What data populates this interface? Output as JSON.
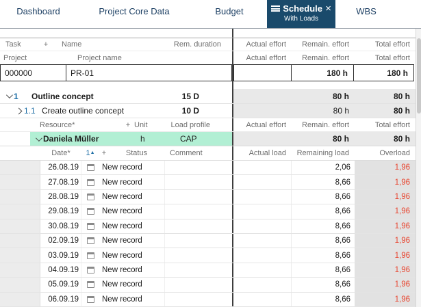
{
  "colors": {
    "active_tab": "#1a4a6b",
    "highlight_green": "#b2efd4",
    "overload_red": "#e8432d",
    "link_blue": "#1f6fa6"
  },
  "tabs": {
    "dashboard": "Dashboard",
    "project_core_data": "Project Core Data",
    "budget": "Budget",
    "schedule": "Schedule",
    "schedule_sub": "With Loads",
    "close": "×",
    "wbs": "WBS"
  },
  "table": {
    "header1": {
      "task": "Task",
      "add": "+",
      "name": "Name",
      "rem_duration": "Rem. duration",
      "actual_effort": "Actual effort",
      "remain_effort": "Remain. effort",
      "total_effort": "Total effort"
    },
    "header2": {
      "project": "Project",
      "project_name": "Project name",
      "actual_effort": "Actual effort",
      "remain_effort": "Remain. effort",
      "total_effort": "Total effort"
    },
    "project_row": {
      "id": "000000",
      "name": "PR-01",
      "actual_effort": "",
      "remain_effort": "180 h",
      "total_effort": "180 h"
    },
    "tasks": [
      {
        "num": "1",
        "name": "Outline concept",
        "rem_duration": "15 D",
        "actual_effort": "",
        "remain_effort": "80 h",
        "total_effort": "80 h"
      },
      {
        "num": "1.1",
        "name": "Create outline concept",
        "rem_duration": "10 D",
        "actual_effort": "",
        "remain_effort": "80 h",
        "total_effort": "80 h"
      }
    ],
    "resource_header": {
      "resource": "Resource*",
      "add": "+",
      "unit": "Unit",
      "load_profile": "Load profile",
      "actual_effort": "Actual effort",
      "remain_effort": "Remain. effort",
      "total_effort": "Total effort"
    },
    "resource": {
      "name": "Daniela Müller",
      "unit": "h",
      "load_profile": "CAP",
      "actual_effort": "",
      "remain_effort": "80 h",
      "total_effort": "80 h"
    },
    "load_header": {
      "date": "Date*",
      "sort": "1",
      "sort_arrow": "▲",
      "add": "+",
      "status": "Status",
      "comment": "Comment",
      "actual_load": "Actual load",
      "remaining_load": "Remaining load",
      "overload": "Overload"
    },
    "loads": [
      {
        "date": "26.08.19",
        "status": "New record",
        "comment": "",
        "actual_load": "",
        "remaining_load": "2,06",
        "overload": "1,96"
      },
      {
        "date": "27.08.19",
        "status": "New record",
        "comment": "",
        "actual_load": "",
        "remaining_load": "8,66",
        "overload": "1,96"
      },
      {
        "date": "28.08.19",
        "status": "New record",
        "comment": "",
        "actual_load": "",
        "remaining_load": "8,66",
        "overload": "1,96"
      },
      {
        "date": "29.08.19",
        "status": "New record",
        "comment": "",
        "actual_load": "",
        "remaining_load": "8,66",
        "overload": "1,96"
      },
      {
        "date": "30.08.19",
        "status": "New record",
        "comment": "",
        "actual_load": "",
        "remaining_load": "8,66",
        "overload": "1,96"
      },
      {
        "date": "02.09.19",
        "status": "New record",
        "comment": "",
        "actual_load": "",
        "remaining_load": "8,66",
        "overload": "1,96"
      },
      {
        "date": "03.09.19",
        "status": "New record",
        "comment": "",
        "actual_load": "",
        "remaining_load": "8,66",
        "overload": "1,96"
      },
      {
        "date": "04.09.19",
        "status": "New record",
        "comment": "",
        "actual_load": "",
        "remaining_load": "8,66",
        "overload": "1,96"
      },
      {
        "date": "05.09.19",
        "status": "New record",
        "comment": "",
        "actual_load": "",
        "remaining_load": "8,66",
        "overload": "1,96"
      },
      {
        "date": "06.09.19",
        "status": "New record",
        "comment": "",
        "actual_load": "",
        "remaining_load": "8,66",
        "overload": "1,96"
      }
    ]
  }
}
